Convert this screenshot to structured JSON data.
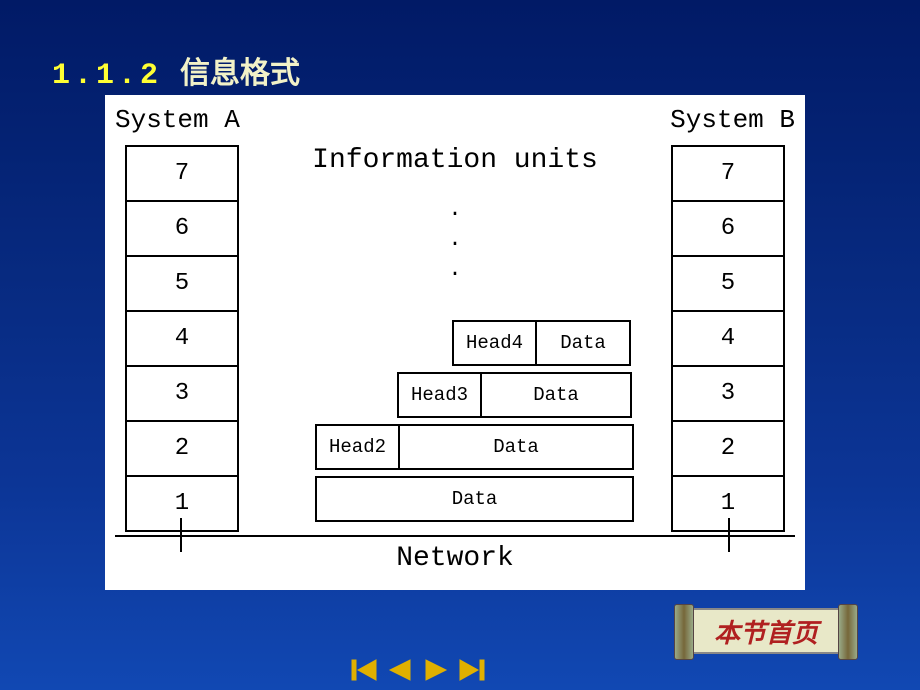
{
  "title": {
    "number": "1.1.2",
    "text": "信息格式"
  },
  "labels": {
    "systemA": "System A",
    "systemB": "System B",
    "infoUnits": "Information units",
    "network": "Network"
  },
  "layers": [
    "7",
    "6",
    "5",
    "4",
    "3",
    "2",
    "1"
  ],
  "dots": ".\n.\n.",
  "units": {
    "u4": {
      "head": "Head4",
      "data": "Data"
    },
    "u3": {
      "head": "Head3",
      "data": "Data"
    },
    "u2": {
      "head": "Head2",
      "data": "Data"
    },
    "u1": {
      "data": "Data"
    }
  },
  "buttons": {
    "sectionHome": "本节首页"
  },
  "icons": {
    "first": "first-icon",
    "prev": "prev-icon",
    "next": "next-icon",
    "last": "last-icon"
  }
}
